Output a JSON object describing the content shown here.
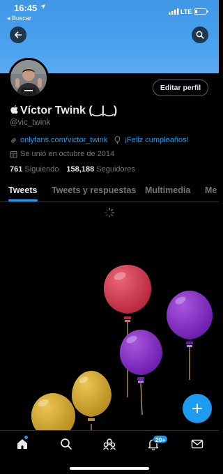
{
  "status_bar": {
    "time": "16:45",
    "back_app": "◂ Buscar",
    "network": "LTE"
  },
  "profile": {
    "name": "Víctor Twink (‿|‿)",
    "handle": "@vic_twink",
    "website": "onlyfans.com/victor_twink",
    "birthday": "¡Feliz cumpleaños!",
    "joined": "Se unió en octubre de 2014",
    "following_count": "761",
    "following_label": "Siguiendo",
    "followers_count": "158,188",
    "followers_label": "Seguidores",
    "edit_button": "Editar perfil"
  },
  "tabs": [
    {
      "label": "Tweets",
      "active": true
    },
    {
      "label": "Tweets y respuestas",
      "active": false
    },
    {
      "label": "Multimedia",
      "active": false
    },
    {
      "label": "Me",
      "active": false
    }
  ],
  "bottom_nav": {
    "notifications_badge": "20+"
  },
  "colors": {
    "accent": "#1d9bf0",
    "banner": "#4aa1ee",
    "balloon_red": "#d63b55",
    "balloon_purple": "#8a2fc9",
    "balloon_yellow": "#d9b233"
  }
}
